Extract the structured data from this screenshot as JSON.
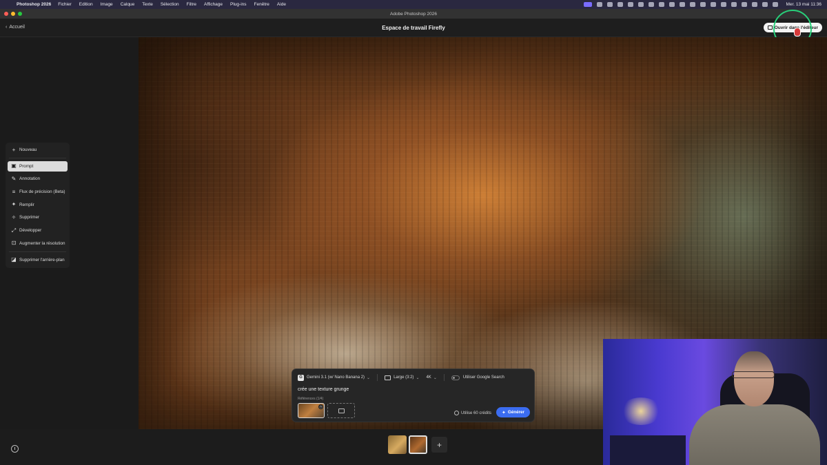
{
  "menubar": {
    "app_name": "Photoshop 2026",
    "menus": [
      "Fichier",
      "Edition",
      "Image",
      "Calque",
      "Texte",
      "Sélection",
      "Filtre",
      "Affichage",
      "Plug-ins",
      "Fenêtre",
      "Aide"
    ],
    "clock": "Mer. 13 mai  11:36"
  },
  "window": {
    "title": "Adobe Photoshop 2026"
  },
  "header": {
    "back_label": "Accueil",
    "title": "Espace de travail Firefly",
    "open_button": "Ouvrir dans l'éditeur"
  },
  "tools": {
    "items": [
      {
        "label": "Nouveau",
        "icon": "plus-icon"
      },
      {
        "label": "Prompt",
        "icon": "prompt-icon",
        "selected": true
      },
      {
        "label": "Annotation",
        "icon": "annotation-icon"
      },
      {
        "label": "Flux de précision (Beta)",
        "icon": "precision-flow-icon"
      },
      {
        "label": "Remplir",
        "icon": "fill-icon"
      },
      {
        "label": "Supprimer",
        "icon": "remove-icon"
      },
      {
        "label": "Développer",
        "icon": "expand-icon"
      },
      {
        "label": "Augmenter la résolution",
        "icon": "upscale-icon"
      },
      {
        "label": "Supprimer l'arrière-plan",
        "icon": "remove-background-icon"
      }
    ]
  },
  "prompt_panel": {
    "model": "Gemini 3.1 (w/ Nano Banana 2)",
    "aspect": "Large (3:2)",
    "resolution": "4K",
    "google_search_label": "Utiliser Google Search",
    "prompt_text": "crée une texture grunge",
    "references_label": "Références (1/4)",
    "credits": "Utilise 60 crédits",
    "generate_label": "Générer"
  },
  "colors": {
    "accent": "#3b6cf0",
    "highlight_ring": "#28d07a",
    "panel": "#262626",
    "background": "#1b1b1b"
  }
}
